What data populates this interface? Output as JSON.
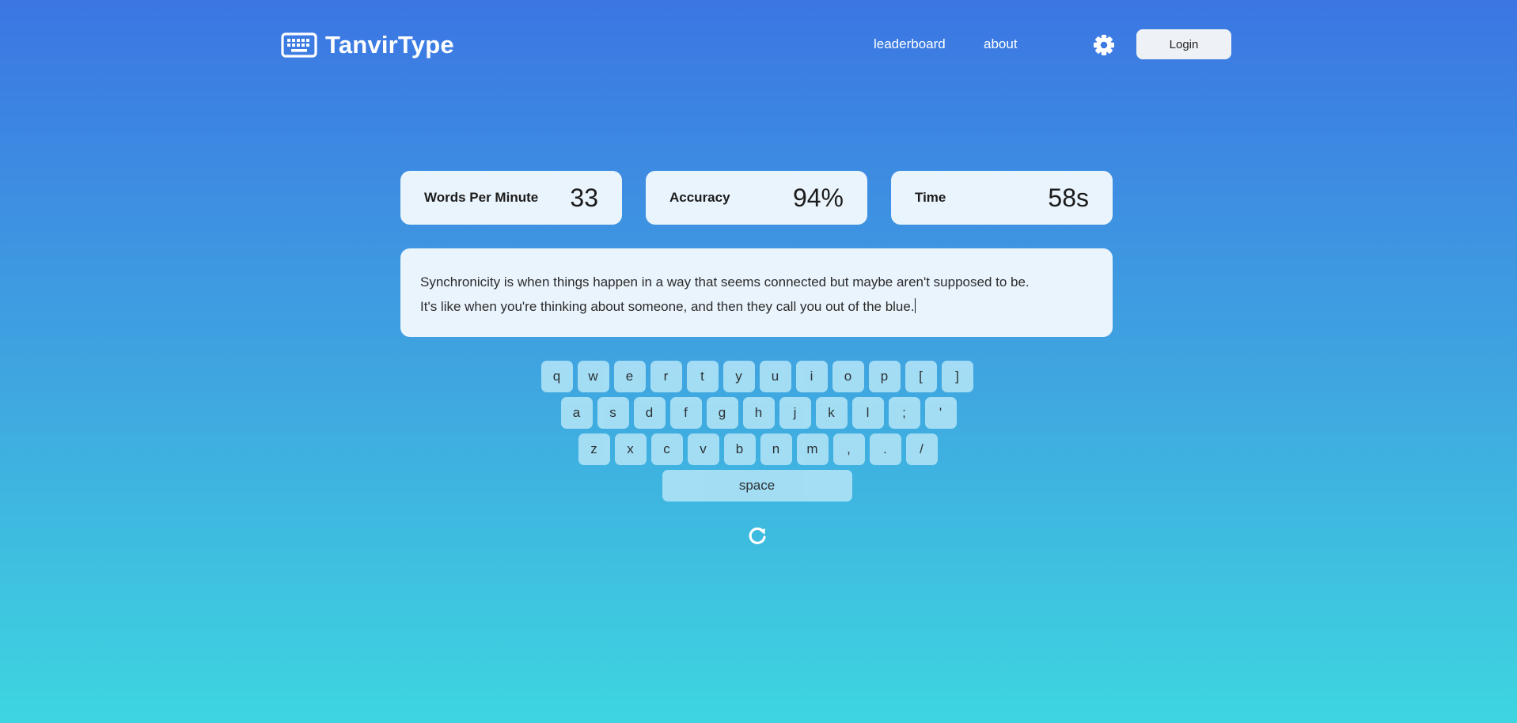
{
  "app": {
    "logo_text": "TanvirType"
  },
  "nav": {
    "leaderboard": "leaderboard",
    "about": "about",
    "login": "Login",
    "settings_icon": "gear-icon"
  },
  "stats": {
    "wpm": {
      "label": "Words Per Minute",
      "value": "33"
    },
    "accuracy": {
      "label": "Accuracy",
      "value": "94%"
    },
    "time": {
      "label": "Time",
      "value": "58s"
    }
  },
  "typing": {
    "line1": "Synchronicity is when things happen in a way that seems connected but maybe aren't supposed to be.",
    "line2": "It's like when you're thinking about someone, and then they call you out of the blue."
  },
  "keyboard": {
    "row1": [
      "q",
      "w",
      "e",
      "r",
      "t",
      "y",
      "u",
      "i",
      "o",
      "p",
      "[",
      "]"
    ],
    "row2": [
      "a",
      "s",
      "d",
      "f",
      "g",
      "h",
      "j",
      "k",
      "l",
      ";",
      "'"
    ],
    "row3": [
      "z",
      "x",
      "c",
      "v",
      "b",
      "n",
      "m",
      ",",
      ".",
      "/"
    ],
    "space": "space"
  },
  "colors": {
    "gradient_top": "#3b76e3",
    "gradient_bottom": "#3dd6e0",
    "card_bg": "#eaf4fc",
    "key_bg": "#a9e0f6"
  },
  "icons": {
    "logo": "keyboard-icon",
    "reset": "reload-icon"
  }
}
